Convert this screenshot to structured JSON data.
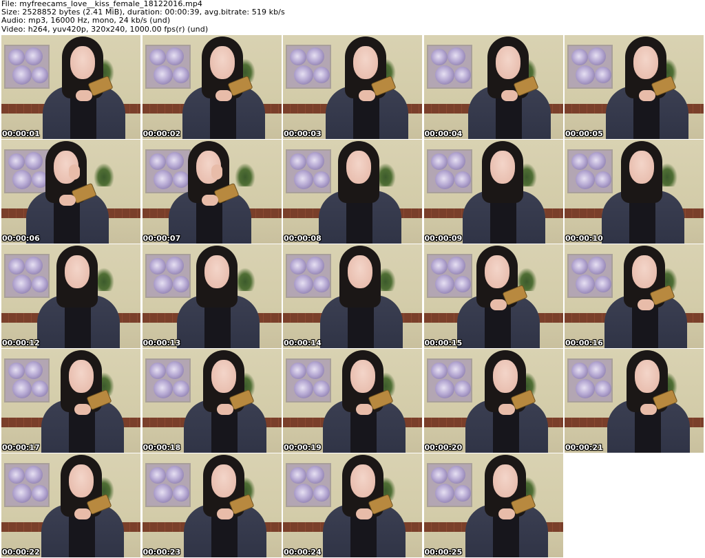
{
  "header": {
    "file_line": "File: myfreecams_love__kiss_female_18122016.mp4",
    "size_line": "Size: 2528852 bytes (2.41 MiB), duration: 00:00:39, avg.bitrate: 519 kb/s",
    "audio_line": "Audio: mp3, 16000 Hz, mono, 24 kb/s (und)",
    "video_line": "Video: h264, yuv420p, 320x240, 1000.00 fps(r) (und)"
  },
  "thumbnails": [
    {
      "time": "00:00:01",
      "pose": "phone"
    },
    {
      "time": "00:00:02",
      "pose": "phone"
    },
    {
      "time": "00:00:03",
      "pose": "phone"
    },
    {
      "time": "00:00:04",
      "pose": "phone"
    },
    {
      "time": "00:00:05",
      "pose": "phone"
    },
    {
      "time": "00:00:06",
      "pose": "face-touch"
    },
    {
      "time": "00:00:07",
      "pose": "face-touch"
    },
    {
      "time": "00:00:08",
      "pose": "standing"
    },
    {
      "time": "00:00:09",
      "pose": "standing"
    },
    {
      "time": "00:00:10",
      "pose": "standing"
    },
    {
      "time": "00:00:12",
      "pose": "standing"
    },
    {
      "time": "00:00:13",
      "pose": "standing"
    },
    {
      "time": "00:00:14",
      "pose": "standing"
    },
    {
      "time": "00:00:15",
      "pose": "phone"
    },
    {
      "time": "00:00:16",
      "pose": "phone"
    },
    {
      "time": "00:00:17",
      "pose": "phone"
    },
    {
      "time": "00:00:18",
      "pose": "phone"
    },
    {
      "time": "00:00:19",
      "pose": "phone"
    },
    {
      "time": "00:00:20",
      "pose": "phone"
    },
    {
      "time": "00:00:21",
      "pose": "phone"
    },
    {
      "time": "00:00:22",
      "pose": "phone"
    },
    {
      "time": "00:00:23",
      "pose": "phone"
    },
    {
      "time": "00:00:24",
      "pose": "phone"
    },
    {
      "time": "00:00:25",
      "pose": "phone"
    }
  ],
  "colors": {
    "background": "#ffffff",
    "header_text": "#000000",
    "timestamp_text": "#ffffff"
  }
}
